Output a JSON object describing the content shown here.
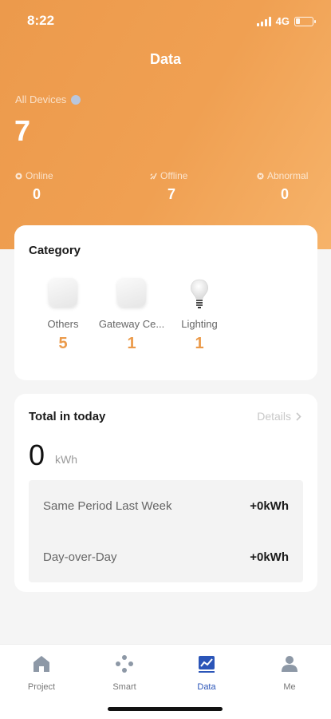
{
  "status_bar": {
    "time": "8:22",
    "network": "4G"
  },
  "header": {
    "title": "Data",
    "all_devices_label": "All Devices",
    "all_devices_count": "7",
    "stats": [
      {
        "label": "Online",
        "value": "0"
      },
      {
        "label": "Offline",
        "value": "7"
      },
      {
        "label": "Abnormal",
        "value": "0"
      }
    ]
  },
  "category": {
    "title": "Category",
    "items": [
      {
        "label": "Others",
        "count": "5",
        "icon": "device-box-icon"
      },
      {
        "label": "Gateway Ce...",
        "count": "1",
        "icon": "gateway-box-icon"
      },
      {
        "label": "Lighting",
        "count": "1",
        "icon": "light-bulb-icon"
      }
    ]
  },
  "energy": {
    "title": "Total in today",
    "details_label": "Details",
    "value": "0",
    "unit": "kWh",
    "comparisons": [
      {
        "label": "Same Period Last Week",
        "value": "+0kWh"
      },
      {
        "label": "Day-over-Day",
        "value": "+0kWh"
      }
    ]
  },
  "tabs": [
    {
      "label": "Project",
      "icon": "home-icon",
      "active": false
    },
    {
      "label": "Smart",
      "icon": "smart-icon",
      "active": false
    },
    {
      "label": "Data",
      "icon": "chart-icon",
      "active": true
    },
    {
      "label": "Me",
      "icon": "person-icon",
      "active": false
    }
  ],
  "colors": {
    "header": "#f0a052",
    "accent_count": "#eb9a4a",
    "active_tab": "#2b55b8"
  }
}
